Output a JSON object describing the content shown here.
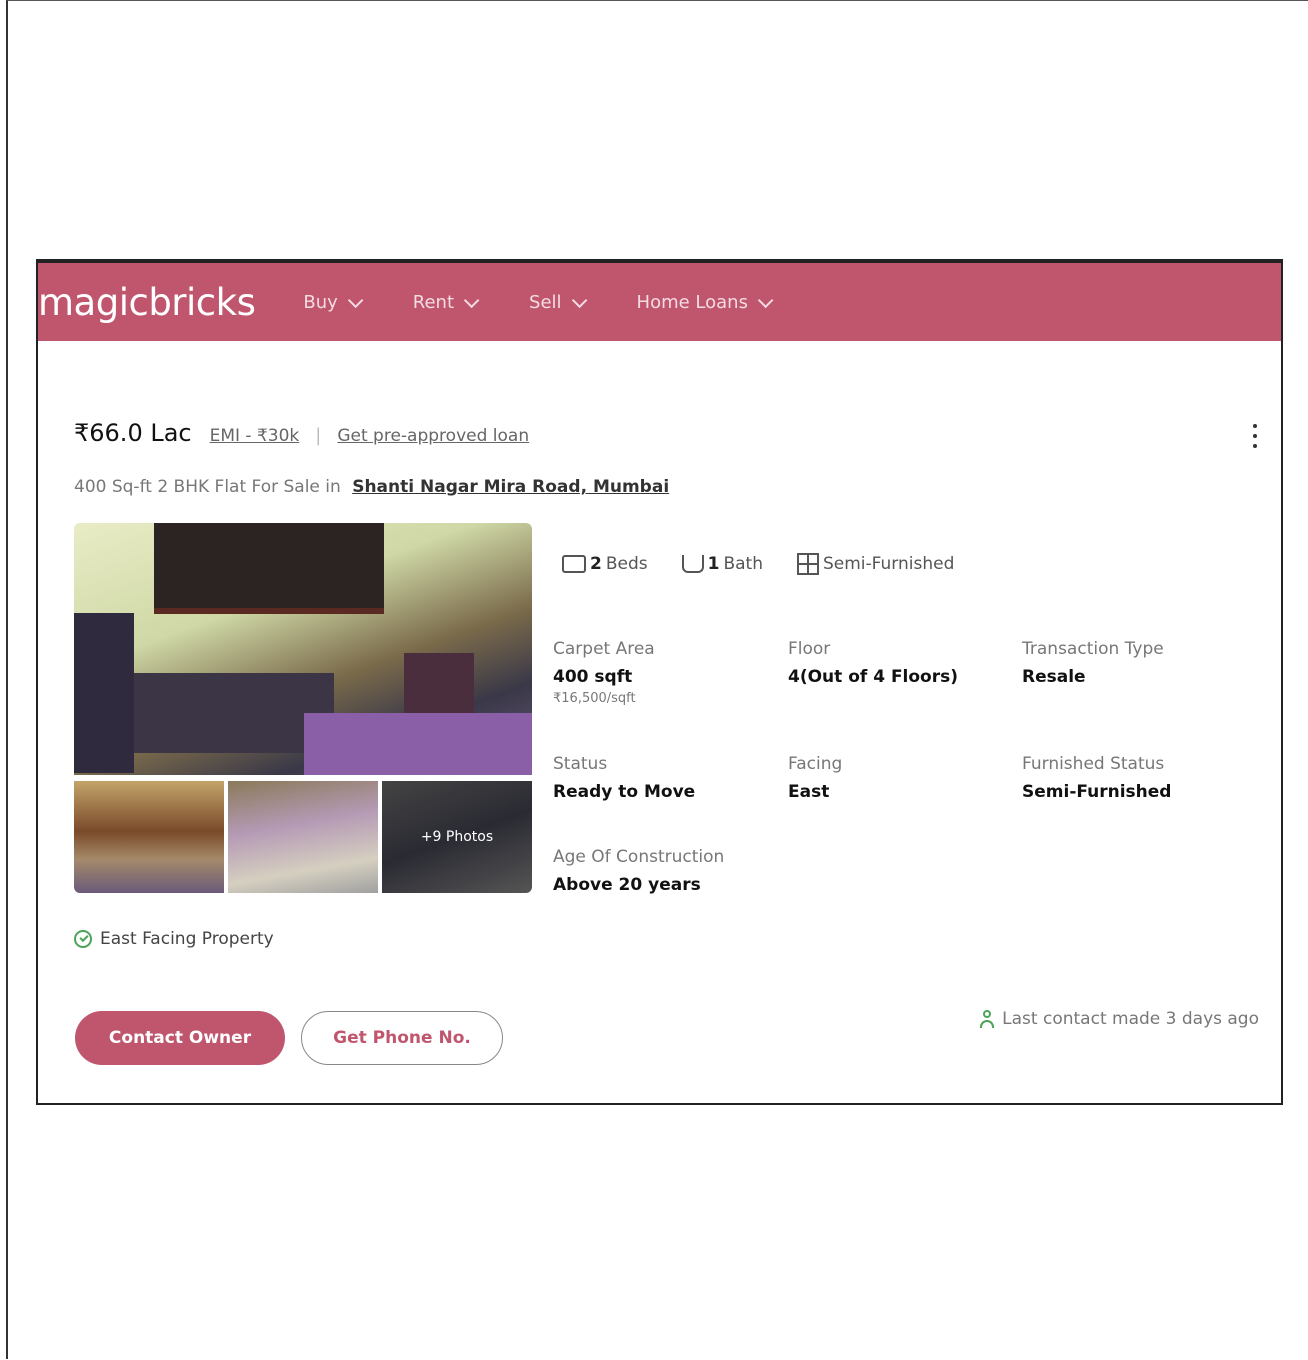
{
  "nav": {
    "logo": "magicbricks",
    "items": [
      {
        "label": "Buy"
      },
      {
        "label": "Rent"
      },
      {
        "label": "Sell"
      },
      {
        "label": "Home Loans"
      }
    ]
  },
  "listing": {
    "price": "₹66.0 Lac",
    "emi": "EMI - ₹30k",
    "loan_link": "Get pre-approved loan",
    "subtitle_prefix": "400 Sq-ft 2 BHK Flat For Sale in",
    "locality": "Shanti Nagar Mira Road, Mumbai",
    "photos_more": "+9 Photos",
    "amenities": {
      "beds": "2",
      "beds_label": "Beds",
      "baths": "1",
      "baths_label": "Bath",
      "furnishing": "Semi-Furnished"
    },
    "details": {
      "carpet_area_label": "Carpet Area",
      "carpet_area_value": "400 sqft",
      "price_per_sqft": "₹16,500/sqft",
      "floor_label": "Floor",
      "floor_value": "4(Out of 4 Floors)",
      "transaction_label": "Transaction Type",
      "transaction_value": "Resale",
      "status_label": "Status",
      "status_value": "Ready to Move",
      "facing_label": "Facing",
      "facing_value": "East",
      "furnished_label": "Furnished Status",
      "furnished_value": "Semi-Furnished",
      "age_label": "Age Of Construction",
      "age_value": "Above 20 years"
    },
    "highlight": "East Facing Property",
    "contact_owner": "Contact Owner",
    "get_phone": "Get Phone No.",
    "last_contact": "Last contact made 3 days ago"
  },
  "colors": {
    "brand": "#c0566e",
    "check_green": "#4ca35a"
  },
  "icons": [
    "chevron-down-icon",
    "kebab-menu-icon",
    "bed-icon",
    "bath-icon",
    "furnishing-icon",
    "check-circle-icon",
    "person-icon"
  ]
}
